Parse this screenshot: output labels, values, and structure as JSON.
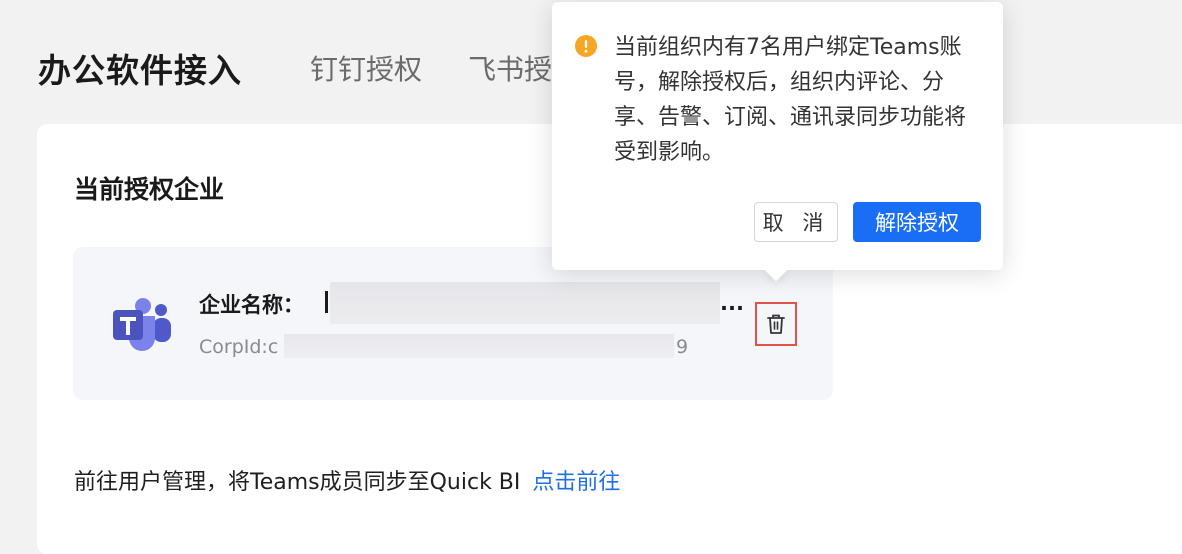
{
  "header": {
    "title": "办公软件接入",
    "tabs": [
      {
        "label": "钉钉授权"
      },
      {
        "label": "飞书授"
      }
    ]
  },
  "section": {
    "title": "当前授权企业"
  },
  "corp": {
    "name_label": "企业名称：",
    "name_ellipsis": "...",
    "corpid_prefix": "CorpId:c",
    "corpid_suffix": "9",
    "delete_icon": "trash-icon"
  },
  "hint": {
    "text": "前往用户管理，将Teams成员同步至Quick BI",
    "link": "点击前往"
  },
  "popover": {
    "icon": "warning-icon",
    "message": "当前组织内有7名用户绑定Teams账号，解除授权后，组织内评论、分享、告警、订阅、通讯录同步功能将受到影响。",
    "cancel_label": "取 消",
    "confirm_label": "解除授权"
  },
  "colors": {
    "accent": "#1a6ef5",
    "link": "#1f6fe5",
    "warning": "#f5a623",
    "highlight_border": "#e0524a",
    "teams_purple": "#5b5fc7"
  }
}
